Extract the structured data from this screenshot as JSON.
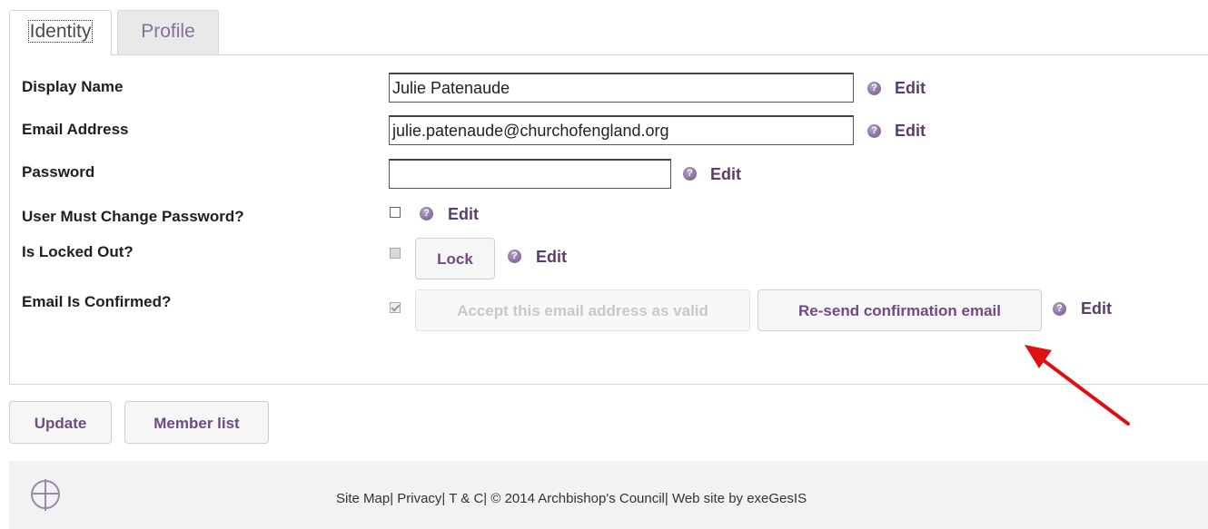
{
  "tabs": [
    {
      "label": "Identity",
      "active": true
    },
    {
      "label": "Profile",
      "active": false
    }
  ],
  "fields": {
    "display_name": {
      "label": "Display Name",
      "value": "Julie Patenaude",
      "edit": "Edit"
    },
    "email": {
      "label": "Email Address",
      "value": "julie.patenaude@churchofengland.org",
      "edit": "Edit"
    },
    "password": {
      "label": "Password",
      "value": "",
      "edit": "Edit"
    },
    "must_change": {
      "label": "User Must Change Password?",
      "checked": false,
      "edit": "Edit"
    },
    "locked_out": {
      "label": "Is Locked Out?",
      "checked": false,
      "lock_button": "Lock",
      "edit": "Edit"
    },
    "email_confirmed": {
      "label": "Email Is Confirmed?",
      "checked": true,
      "accept_button": "Accept this email address as valid",
      "resend_button": "Re-send confirmation email",
      "edit": "Edit"
    }
  },
  "help_glyph": "?",
  "actions": {
    "update": "Update",
    "member_list": "Member list"
  },
  "footer": {
    "logo_icon": "church-of-england-cross-logo",
    "text": "Site Map| Privacy| T & C| © 2014 Archbishop's Council| Web site by exeGesIS"
  },
  "colors": {
    "accent": "#6f4b86",
    "edit": "#5a3d6e",
    "annotation_arrow": "#e01010"
  }
}
